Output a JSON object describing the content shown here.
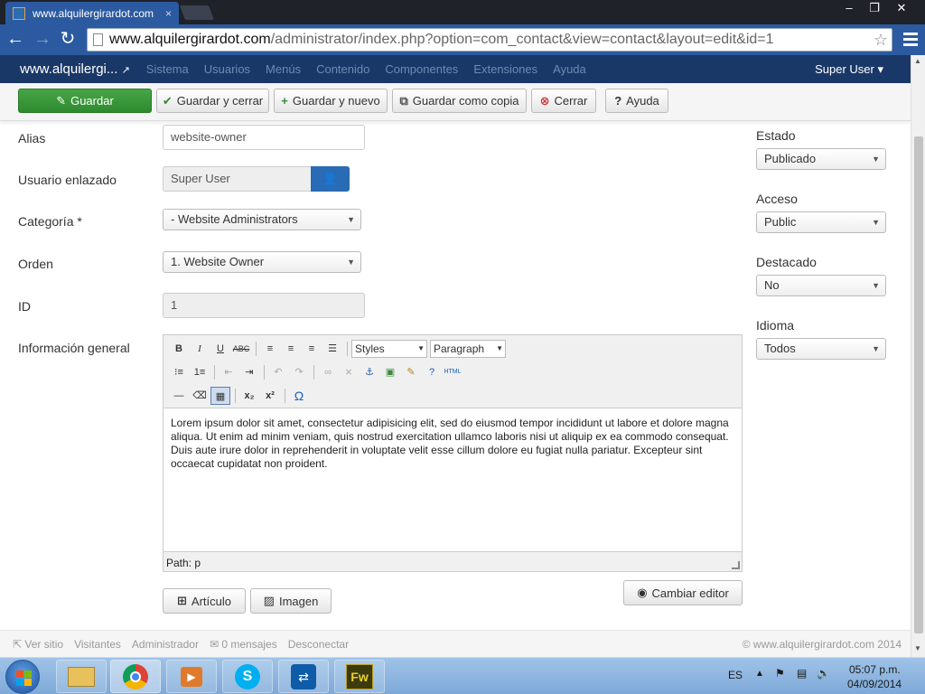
{
  "browser": {
    "tab_title": "www.alquilergirardot.com",
    "tab_close": "×",
    "url_host": "www.alquilergirardot.com",
    "url_rest": "/administrator/index.php?option=com_contact&view=contact&layout=edit&id=1"
  },
  "admin_nav": {
    "brand": "www.alquilergi...",
    "items": [
      "Sistema",
      "Usuarios",
      "Menús",
      "Contenido",
      "Componentes",
      "Extensiones",
      "Ayuda"
    ],
    "user": "Super User ▾"
  },
  "toolbar": {
    "save": "Guardar",
    "save_close": "Guardar y cerrar",
    "save_new": "Guardar y nuevo",
    "save_copy": "Guardar como copia",
    "close": "Cerrar",
    "help": "Ayuda"
  },
  "form": {
    "alias_label": "Alias",
    "alias_value": "website-owner",
    "linked_user_label": "Usuario enlazado",
    "linked_user_value": "Super User",
    "category_label": "Categoría *",
    "category_value": "- Website Administrators",
    "order_label": "Orden",
    "order_value": "1. Website Owner",
    "id_label": "ID",
    "id_value": "1",
    "info_label": "Información general"
  },
  "editor": {
    "styles_select": "Styles",
    "format_select": "Paragraph",
    "content": "Lorem ipsum dolor sit amet, consectetur adipisicing elit, sed do eiusmod tempor incididunt ut labore et dolore magna aliqua. Ut enim ad minim veniam, quis nostrud exercitation ullamco laboris nisi ut aliquip ex ea commodo consequat. Duis aute irure dolor in reprehenderit in voluptate velit esse cillum dolore eu fugiat nulla pariatur. Excepteur sint occaecat cupidatat non proident.",
    "path": "Path: p",
    "btn_article": "Artículo",
    "btn_image": "Imagen",
    "btn_toggle": "Cambiar editor"
  },
  "sidebar": {
    "status_label": "Estado",
    "status_value": "Publicado",
    "access_label": "Acceso",
    "access_value": "Public",
    "featured_label": "Destacado",
    "featured_value": "No",
    "language_label": "Idioma",
    "language_value": "Todos"
  },
  "statusbar": {
    "view_site": "Ver sitio",
    "visitors": "Visitantes",
    "admin": "Administrador",
    "messages": "0 mensajes",
    "logout": "Desconectar",
    "copyright": "© www.alquilergirardot.com 2014"
  },
  "taskbar": {
    "lang": "ES",
    "time": "05:07 p.m.",
    "date": "04/09/2014"
  },
  "colors": {
    "nav_bg": "#1a3867",
    "primary_green": "#46a546",
    "link_blue": "#2a6bb5"
  }
}
